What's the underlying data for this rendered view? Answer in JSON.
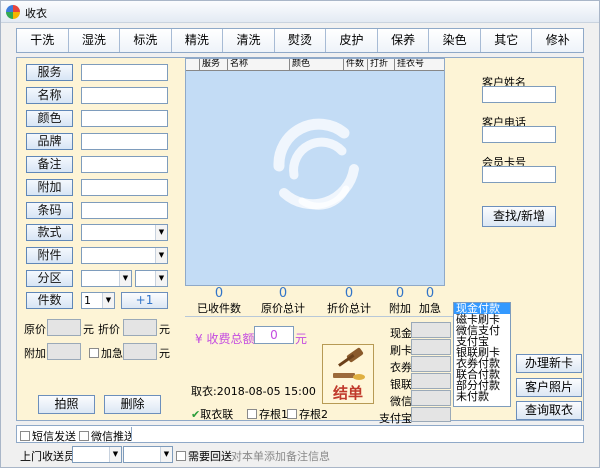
{
  "window": {
    "title": "收衣"
  },
  "tabs": [
    "干洗",
    "湿洗",
    "标洗",
    "精洗",
    "清洗",
    "熨烫",
    "皮护",
    "保养",
    "染色",
    "其它",
    "修补"
  ],
  "left": {
    "fields": [
      "服务",
      "名称",
      "颜色",
      "品牌",
      "备注",
      "附加",
      "条码"
    ],
    "style_label": "款式",
    "accessory_label": "附件",
    "zone_label": "分区",
    "qty_label": "件数",
    "qty_value": "1",
    "plus_one": "+1",
    "price_label": "原价",
    "yuan": "元",
    "discount_label": "折价",
    "extra_label": "附加",
    "urgent_label": "加急",
    "photo_button": "拍照",
    "delete_button": "删除"
  },
  "grid": {
    "columns": [
      "服务",
      "名称",
      "颜色",
      "件数",
      "打折",
      "挂衣号"
    ]
  },
  "totals": [
    {
      "value": "0",
      "label": "已收件数"
    },
    {
      "value": "0",
      "label": "原价总计"
    },
    {
      "value": "0",
      "label": "折价总计"
    },
    {
      "value": "0",
      "label": "附加"
    },
    {
      "value": "0",
      "label": "加急"
    }
  ],
  "fee": {
    "label": "¥ 收费总额",
    "value": "0",
    "unit": "元"
  },
  "pickup": {
    "label": "取衣:2018-08-05 15:00"
  },
  "settle_button": "结单",
  "checks": [
    "取衣联",
    "存根1",
    "存根2"
  ],
  "payment_fields": [
    "现金",
    "刷卡",
    "衣券",
    "银联",
    "微信",
    "支付宝"
  ],
  "payment_methods": [
    "现金付款",
    "磁卡刷卡",
    "微信支付",
    "支付宝",
    "银联刷卡",
    "衣券付款",
    "联合付款",
    "部分付款",
    "未付款"
  ],
  "customer": {
    "name_label": "客户姓名",
    "phone_label": "客户电话",
    "card_label": "会员卡号",
    "search_button": "查找/新增"
  },
  "right_buttons": [
    "办理新卡",
    "客户照片",
    "查询取衣"
  ],
  "footer": {
    "sms": "短信发送",
    "wechat": "微信推送"
  },
  "bottom": {
    "courier_label": "上门收送员",
    "need_return": "需要回送",
    "note_hint": "对本单添加备注信息"
  },
  "colors": {
    "frame_bg": "#fdf4d6",
    "grid_bg": "#c3dcf5",
    "accent": "#3274c8",
    "fee_color": "#c44be0"
  }
}
